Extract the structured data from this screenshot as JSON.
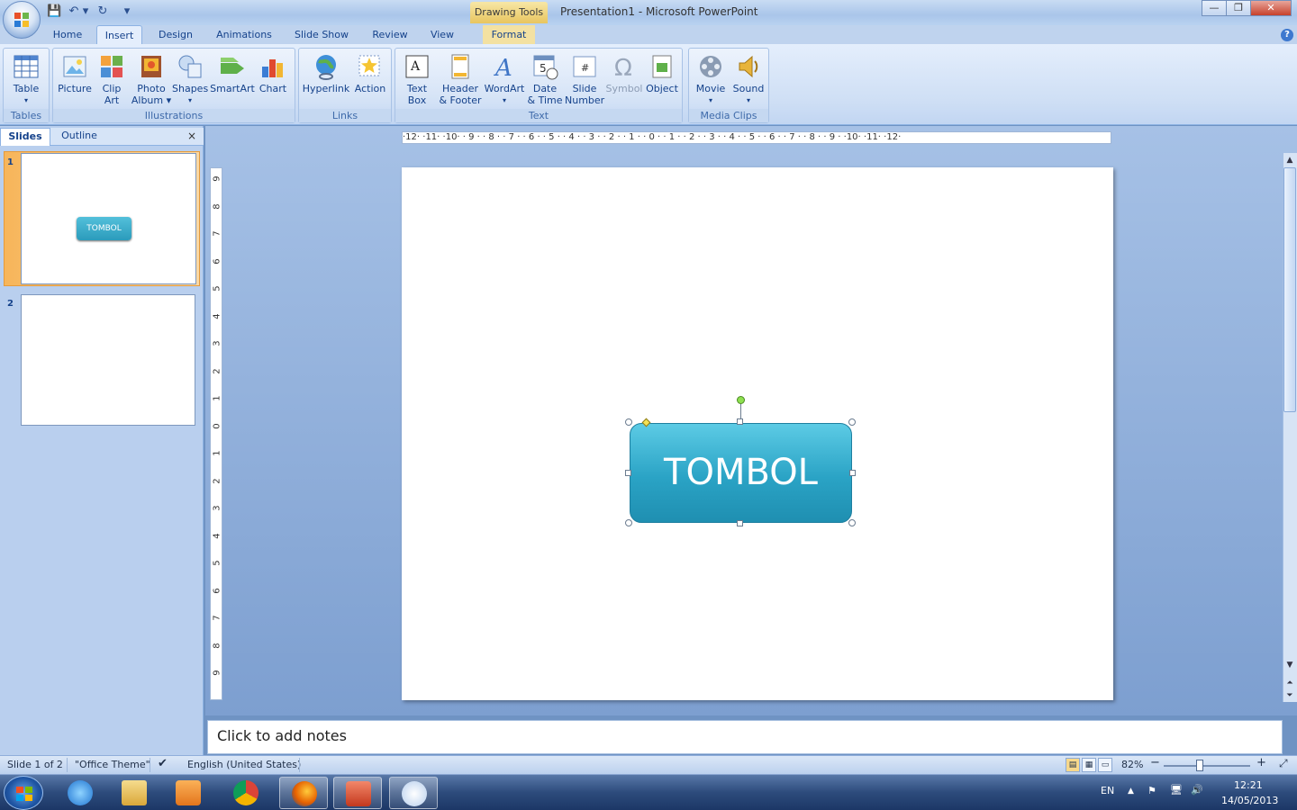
{
  "window": {
    "context_tab": "Drawing Tools",
    "title": "Presentation1 - Microsoft PowerPoint",
    "min": "—",
    "max": "❐",
    "close": "✕"
  },
  "qat": {
    "save": "💾",
    "undo": "↶",
    "undo_drop": "▾",
    "redo": "↻",
    "customize": "▾"
  },
  "tabs": [
    "Home",
    "Insert",
    "Design",
    "Animations",
    "Slide Show",
    "Review",
    "View",
    "Format"
  ],
  "active_tab": "Insert",
  "help": "?",
  "ribbon": {
    "groups": {
      "tables": "Tables",
      "illustrations": "Illustrations",
      "links": "Links",
      "text": "Text",
      "media": "Media Clips"
    },
    "buttons": {
      "table": "Table",
      "picture": "Picture",
      "clip_art": "Clip\nArt",
      "photo_album": "Photo\nAlbum ▾",
      "shapes": "Shapes",
      "smartart": "SmartArt",
      "chart": "Chart",
      "hyperlink": "Hyperlink",
      "action": "Action",
      "text_box": "Text\nBox",
      "header_footer": "Header\n& Footer",
      "wordart": "WordArt",
      "date_time": "Date\n& Time",
      "slide_number": "Slide\nNumber",
      "symbol": "Symbol",
      "object": "Object",
      "movie": "Movie",
      "sound": "Sound"
    },
    "dropdown_arrow": "▾"
  },
  "pane": {
    "tab_slides": "Slides",
    "tab_outline": "Outline",
    "close": "×",
    "slides": [
      {
        "num": "1",
        "shape_text": "TOMBOL"
      },
      {
        "num": "2"
      }
    ]
  },
  "ruler": {
    "h": "·12· ·11· ·10· · 9 · · 8 · · 7 · · 6 · · 5 · · 4 · · 3 · · 2 · · 1 · · 0 · · 1 · · 2 · · 3 · · 4 · · 5 · · 6 · · 7 · · 8 · · 9 · ·10· ·11· ·12·",
    "v": [
      "9",
      "8",
      "7",
      "6",
      "5",
      "4",
      "3",
      "2",
      "1",
      "0",
      "1",
      "2",
      "3",
      "4",
      "5",
      "6",
      "7",
      "8",
      "9"
    ]
  },
  "slide": {
    "shape_text": "TOMBOL"
  },
  "notes": {
    "placeholder": "Click to add notes"
  },
  "status": {
    "slide": "Slide 1 of 2",
    "theme": "\"Office Theme\"",
    "language": "English (United States)",
    "zoom": "82%",
    "zoom_out": "−",
    "zoom_in": "+",
    "fit": "⤢"
  },
  "taskbar": {
    "lang": "EN",
    "time": "12:21",
    "date": "14/05/2013",
    "tray_up": "▲"
  },
  "colors": {
    "shape_fill": "#2aa3c5",
    "ribbon": "#e4eefc",
    "ctx_tab": "#e8c55e"
  }
}
